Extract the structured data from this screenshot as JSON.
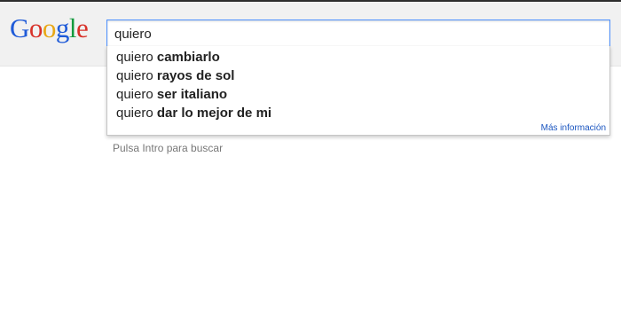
{
  "logo": {
    "letters": [
      "G",
      "o",
      "o",
      "g",
      "l",
      "e"
    ],
    "colors": [
      "#1f5bd8",
      "#d8322a",
      "#e8a715",
      "#1f5bd8",
      "#139a3e",
      "#d8322a"
    ]
  },
  "search": {
    "value": "quiero"
  },
  "suggestions": [
    {
      "typed": "quiero",
      "completion": "cambiarlo"
    },
    {
      "typed": "quiero",
      "completion": "rayos de sol"
    },
    {
      "typed": "quiero",
      "completion": "ser italiano"
    },
    {
      "typed": "quiero",
      "completion": "dar lo mejor de mi"
    }
  ],
  "more_info_label": "Más información",
  "hint_text": "Pulsa Intro para buscar",
  "colors": {
    "focus_border": "#4d90fe",
    "link": "#1a55c0",
    "hint": "#777777"
  }
}
